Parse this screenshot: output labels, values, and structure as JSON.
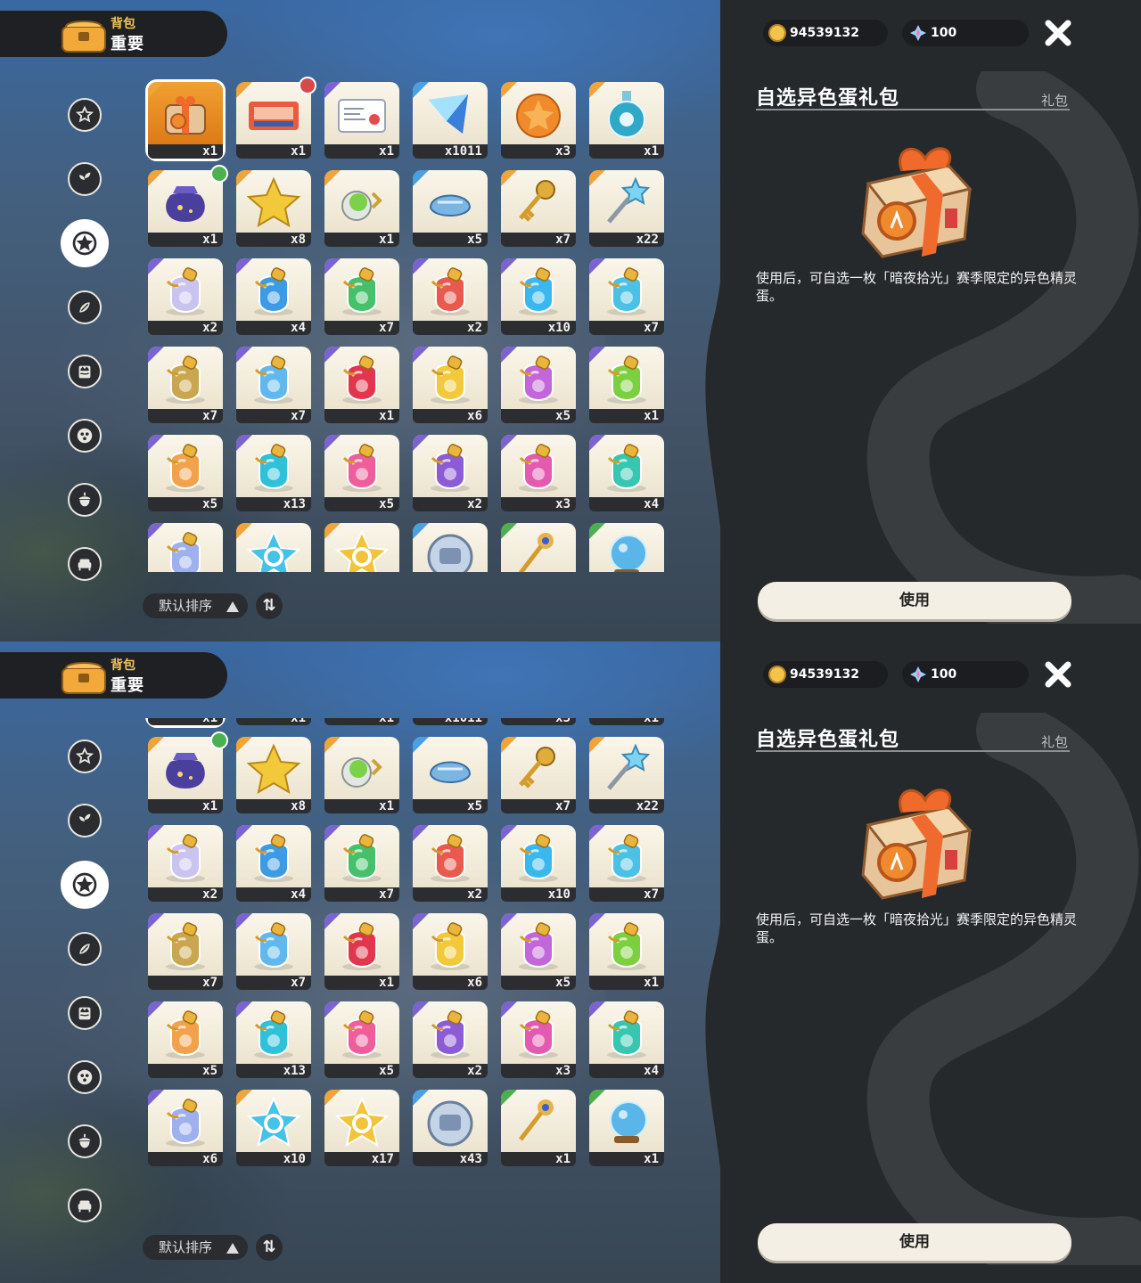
{
  "header": {
    "subtitle": "背包",
    "title": "重要"
  },
  "currency": {
    "coins": "94539132",
    "gems": "100"
  },
  "categories": [
    {
      "name": "star-badge"
    },
    {
      "name": "leaf-sprout"
    },
    {
      "name": "star-burst"
    },
    {
      "name": "leaves"
    },
    {
      "name": "crown-card"
    },
    {
      "name": "pet-ball"
    },
    {
      "name": "acorn"
    },
    {
      "name": "sofa"
    }
  ],
  "active_category": 2,
  "items": [
    {
      "id": "gift_pack",
      "qty": "x1",
      "art": "gift",
      "rarity": "#f0a43a",
      "selected": true
    },
    {
      "id": "ticket_red",
      "qty": "x1",
      "art": "ticket",
      "rarity": "#f0a43a",
      "badge": "#d64a4a"
    },
    {
      "id": "card_letter",
      "qty": "x1",
      "art": "letter",
      "rarity": "#7b63d1"
    },
    {
      "id": "crystal_prism",
      "qty": "x1011",
      "art": "prism",
      "rarity": "#4aa0e0"
    },
    {
      "id": "amber_egg",
      "qty": "x3",
      "art": "amber",
      "rarity": "#f0a43a"
    },
    {
      "id": "blue_flask",
      "qty": "x1",
      "art": "flask",
      "rarity": "#f0a43a"
    },
    {
      "id": "star_pouch",
      "qty": "x1",
      "art": "pouch",
      "rarity": "#f0a43a",
      "badge": "#4caf50"
    },
    {
      "id": "gold_star",
      "qty": "x8",
      "art": "star",
      "rarity": "#f0a43a"
    },
    {
      "id": "green_charm",
      "qty": "x1",
      "art": "charm",
      "rarity": "#f0a43a"
    },
    {
      "id": "blue_shell",
      "qty": "x5",
      "art": "shell",
      "rarity": "#4aa0e0"
    },
    {
      "id": "gold_key",
      "qty": "x7",
      "art": "key",
      "rarity": "#f0a43a"
    },
    {
      "id": "star_wand",
      "qty": "x22",
      "art": "wand",
      "rarity": "#f0a43a"
    },
    {
      "id": "rainbow_potion",
      "qty": "x2",
      "art": "potion",
      "potion": "#c9c3f0",
      "rarity": "#7b63d1"
    },
    {
      "id": "potion_blue",
      "qty": "x4",
      "art": "potion",
      "potion": "#3d9be6",
      "rarity": "#7b63d1"
    },
    {
      "id": "potion_green",
      "qty": "x7",
      "art": "potion",
      "potion": "#45c06b",
      "rarity": "#7b63d1"
    },
    {
      "id": "potion_red",
      "qty": "x2",
      "art": "potion",
      "potion": "#e9594d",
      "rarity": "#7b63d1"
    },
    {
      "id": "potion_cyan",
      "qty": "x10",
      "art": "potion",
      "potion": "#39b8ef",
      "rarity": "#7b63d1"
    },
    {
      "id": "potion_sky",
      "qty": "x7",
      "art": "potion",
      "potion": "#4cc1e6",
      "rarity": "#7b63d1"
    },
    {
      "id": "potion_brown",
      "qty": "x7",
      "art": "potion",
      "potion": "#c9a64f",
      "rarity": "#7b63d1"
    },
    {
      "id": "potion_ice",
      "qty": "x7",
      "art": "potion",
      "potion": "#61b8ef",
      "rarity": "#7b63d1"
    },
    {
      "id": "potion_crimson",
      "qty": "x1",
      "art": "potion",
      "potion": "#e2354e",
      "rarity": "#7b63d1"
    },
    {
      "id": "potion_yellow",
      "qty": "x6",
      "art": "potion",
      "potion": "#f2c93a",
      "rarity": "#7b63d1"
    },
    {
      "id": "potion_violet",
      "qty": "x5",
      "art": "potion",
      "potion": "#c266d9",
      "rarity": "#7b63d1"
    },
    {
      "id": "potion_lime",
      "qty": "x1",
      "art": "potion",
      "potion": "#7ccf3e",
      "rarity": "#7b63d1"
    },
    {
      "id": "potion_orange",
      "qty": "x5",
      "art": "potion",
      "potion": "#f2a24a",
      "rarity": "#7b63d1"
    },
    {
      "id": "potion_aqua",
      "qty": "x13",
      "art": "potion",
      "potion": "#2fc1d9",
      "rarity": "#7b63d1"
    },
    {
      "id": "potion_pink",
      "qty": "x5",
      "art": "potion",
      "potion": "#ef5d9b",
      "rarity": "#7b63d1"
    },
    {
      "id": "potion_purple",
      "qty": "x2",
      "art": "potion",
      "potion": "#8c5bd6",
      "rarity": "#7b63d1"
    },
    {
      "id": "potion_magenta",
      "qty": "x3",
      "art": "potion",
      "potion": "#e45ab1",
      "rarity": "#7b63d1"
    },
    {
      "id": "potion_teal",
      "qty": "x4",
      "art": "potion",
      "potion": "#37c6b0",
      "rarity": "#7b63d1"
    },
    {
      "id": "potion_lavender",
      "qty": "x6",
      "art": "potion",
      "potion": "#9fb0ee",
      "rarity": "#7b63d1"
    },
    {
      "id": "star_cyan",
      "qty": "x10",
      "art": "cstar",
      "tint": "#46c2e8",
      "rarity": "#f0a43a"
    },
    {
      "id": "star_gold",
      "qty": "x17",
      "art": "cstar",
      "tint": "#f2c43a",
      "rarity": "#f0a43a"
    },
    {
      "id": "silver_coin",
      "qty": "x43",
      "art": "coin",
      "rarity": "#4aa0e0"
    },
    {
      "id": "jewel_key",
      "qty": "x1",
      "art": "key2",
      "rarity": "#4caf50"
    },
    {
      "id": "crystal_orb",
      "qty": "x1",
      "art": "orb",
      "rarity": "#4caf50"
    }
  ],
  "sort": {
    "label": "默认排序"
  },
  "detail": {
    "name": "自选异色蛋礼包",
    "type": "礼包",
    "description": "使用后，可自选一枚「暗夜拾光」赛季限定的异色精灵蛋。",
    "use_label": "使用"
  },
  "screens": [
    {
      "grid_scroll_rows": 0
    },
    {
      "grid_scroll_rows": 0.87
    }
  ]
}
